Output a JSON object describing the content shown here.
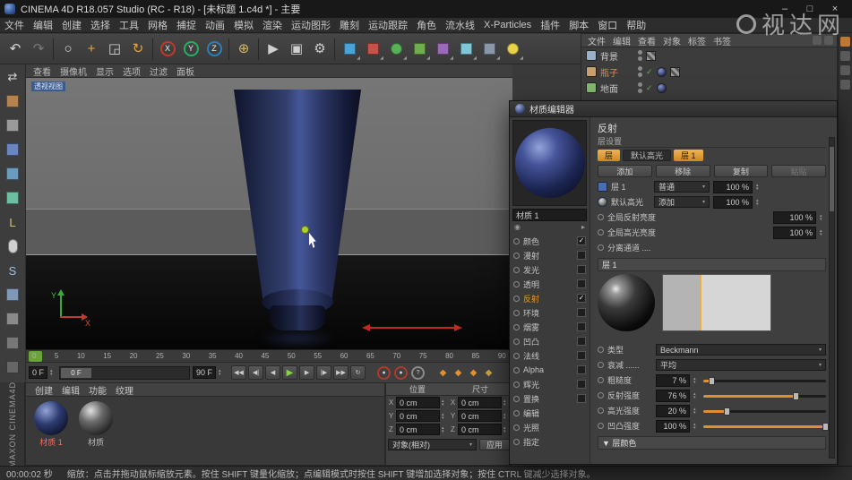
{
  "title_bar": {
    "title": "CINEMA 4D R18.057 Studio (RC - R18) - [未标题 1.c4d *] - 主要",
    "minimize": "–",
    "maximize": "□",
    "close": "×"
  },
  "menu_bar": [
    "文件",
    "编辑",
    "创建",
    "选择",
    "工具",
    "网格",
    "捕捉",
    "动画",
    "模拟",
    "渲染",
    "运动图形",
    "雕刻",
    "运动跟踪",
    "角色",
    "流水线",
    "X-Particles",
    "插件",
    "脚本",
    "窗口",
    "帮助"
  ],
  "toolbar": {
    "groups": [
      {
        "items": [
          {
            "name": "undo-icon",
            "glyph": "↶",
            "color": "#d8d8d8"
          },
          {
            "name": "redo-icon",
            "glyph": "↷",
            "color": "#7a7a7a"
          }
        ]
      },
      {
        "items": [
          {
            "name": "live-selection-icon",
            "glyph": "○",
            "color": "#d8d8d8"
          },
          {
            "name": "move-tool-icon",
            "glyph": "+",
            "color": "#e8a43c"
          },
          {
            "name": "scale-tool-icon",
            "glyph": "◲",
            "color": "#d8d8d8"
          },
          {
            "name": "rotate-tool-icon",
            "glyph": "↻",
            "color": "#e8a43c"
          }
        ]
      },
      {
        "items": [
          {
            "name": "x-axis-lock-button",
            "glyph": "X",
            "ring": "#c0392b"
          },
          {
            "name": "y-axis-lock-button",
            "glyph": "Y",
            "ring": "#27ae60"
          },
          {
            "name": "z-axis-lock-button",
            "glyph": "Z",
            "ring": "#2980b9"
          }
        ]
      },
      {
        "items": [
          {
            "name": "coordinate-system-button",
            "glyph": "⊕",
            "color": "#d8b868"
          }
        ]
      },
      {
        "items": [
          {
            "name": "render-view-button",
            "glyph": "▶",
            "color": "#cfcfcf"
          },
          {
            "name": "render-picture-viewer-button",
            "glyph": "▣",
            "color": "#cfcfcf"
          },
          {
            "name": "render-settings-button",
            "glyph": "⚙",
            "color": "#cfcfcf"
          }
        ]
      },
      {
        "items": [
          {
            "name": "primitive-cube-button",
            "shape": "square",
            "fill": "#4aa3d8",
            "dd": true
          },
          {
            "name": "spline-pen-button",
            "shape": "square",
            "fill": "#c8524a",
            "dd": true
          },
          {
            "name": "subdivision-surface-button",
            "shape": "circle",
            "fill": "#58b058",
            "dd": true
          },
          {
            "name": "cloner-button",
            "shape": "square",
            "fill": "#6fae4e",
            "dd": true
          },
          {
            "name": "deformer-button",
            "shape": "square",
            "fill": "#9a6ab8",
            "dd": true
          },
          {
            "name": "environment-button",
            "shape": "square",
            "fill": "#7ec8d8",
            "dd": true
          },
          {
            "name": "camera-button",
            "shape": "square",
            "fill": "#8a97a8",
            "dd": true
          },
          {
            "name": "light-button",
            "shape": "circle",
            "fill": "#e8d24a",
            "dd": true
          }
        ]
      }
    ]
  },
  "left_toolbar": [
    {
      "name": "make-editable-icon",
      "glyph": "⇄",
      "color": "#cfcfcf"
    },
    {
      "name": "model-mode-icon",
      "shape": "square",
      "fill": "#b5824f"
    },
    {
      "name": "texture-mode-icon",
      "shape": "square",
      "fill": "#9a9a9a"
    },
    {
      "name": "points-mode-icon",
      "shape": "square",
      "fill": "#6a86c0"
    },
    {
      "name": "edges-mode-icon",
      "shape": "square",
      "fill": "#6a9cc0"
    },
    {
      "name": "polygons-mode-icon",
      "shape": "square",
      "fill": "#6ac0a0"
    },
    {
      "name": "axis-mode-icon",
      "glyph": "L",
      "color": "#d8c070"
    },
    {
      "name": "solo-mode-icon",
      "shape": "pill",
      "fill": "#d0d0d0"
    },
    {
      "name": "snap-toggle-icon",
      "glyph": "S",
      "color": "#9ec2e0"
    },
    {
      "name": "workplane-icon",
      "shape": "square",
      "fill": "#8098b8"
    },
    {
      "name": "magnet-icon",
      "shape": "square",
      "fill": "#8a8a8a"
    },
    {
      "name": "array-grid-icon",
      "shape": "square",
      "fill": "#777777"
    },
    {
      "name": "modeling-settings-icon",
      "shape": "square",
      "fill": "#666666"
    }
  ],
  "viewport": {
    "menu": [
      "查看",
      "摄像机",
      "显示",
      "选项",
      "过滤",
      "面板"
    ],
    "view_label": "透视视图",
    "axis_x": "X",
    "axis_y": "Y"
  },
  "timeline_ticks": [
    "0",
    "5",
    "10",
    "15",
    "20",
    "25",
    "30",
    "35",
    "40",
    "45",
    "50",
    "55",
    "60",
    "65",
    "70",
    "75",
    "80",
    "85",
    "90"
  ],
  "playback": {
    "current_frame": "0 F",
    "slider_handle": "0 F",
    "end_frame": "90 F",
    "transport": [
      {
        "name": "goto-start-button",
        "glyph": "◀◀"
      },
      {
        "name": "prev-key-button",
        "glyph": "◀|"
      },
      {
        "name": "prev-frame-button",
        "glyph": "◀"
      },
      {
        "name": "play-button",
        "glyph": "▶",
        "play": true
      },
      {
        "name": "next-frame-button",
        "glyph": "▶"
      },
      {
        "name": "next-key-button",
        "glyph": "|▶"
      },
      {
        "name": "goto-end-button",
        "glyph": "▶▶"
      },
      {
        "name": "loop-button",
        "glyph": "↻"
      }
    ],
    "record_buttons": [
      {
        "name": "record-keyframe-button",
        "glyph": "●",
        "gray": false
      },
      {
        "name": "autokey-button",
        "glyph": "●",
        "gray": false
      },
      {
        "name": "keyframe-help-button",
        "glyph": "?",
        "gray": true
      }
    ],
    "key_icons": [
      {
        "name": "keyframe-position-icon",
        "glyph": "◆",
        "color": "#e0912f"
      },
      {
        "name": "keyframe-scale-icon",
        "glyph": "◆",
        "color": "#e0912f"
      },
      {
        "name": "keyframe-rotation-icon",
        "glyph": "◆",
        "color": "#e0912f"
      },
      {
        "name": "keyframe-parameter-icon",
        "glyph": "◆",
        "color": "#c8a040"
      }
    ]
  },
  "object_manager": {
    "menu": [
      "文件",
      "编辑",
      "查看",
      "对象",
      "标签",
      "书签"
    ],
    "objects": [
      {
        "name": "背景",
        "selected": false,
        "icon": "#9ab0c8",
        "tags": [
          "texture"
        ]
      },
      {
        "name": "瓶子",
        "selected": true,
        "icon": "#c8a070",
        "tags": [
          "check",
          "material",
          "texture"
        ]
      },
      {
        "name": "地面",
        "selected": false,
        "icon": "#84b870",
        "tags": [
          "check",
          "material"
        ]
      }
    ]
  },
  "material_manager": {
    "tabs": [
      "创建",
      "编辑",
      "功能",
      "纹理"
    ],
    "materials": [
      {
        "name": "材质 1",
        "selected": true,
        "ball": "navy"
      },
      {
        "name": "材质",
        "selected": false,
        "ball": "dark"
      }
    ]
  },
  "coordinates": {
    "headers": [
      "位置",
      "尺寸"
    ],
    "axis_labels": [
      "X",
      "Y",
      "Z"
    ],
    "pos": {
      "x": "0 cm",
      "y": "0 cm",
      "z": "0 cm"
    },
    "size": {
      "x": "0 cm",
      "y": "0 cm",
      "z": "0 cm"
    },
    "mode_dropdown": "对象(相对)",
    "apply_button": "应用"
  },
  "material_editor": {
    "window_title": "材质编辑器",
    "material_name": "材质 1",
    "channels": [
      {
        "label": "颜色",
        "checked": true
      },
      {
        "label": "漫射",
        "checked": false
      },
      {
        "label": "发光",
        "checked": false
      },
      {
        "label": "透明",
        "checked": false
      },
      {
        "label": "反射",
        "checked": true,
        "active": true
      },
      {
        "label": "环境",
        "checked": false
      },
      {
        "label": "烟雾",
        "checked": false
      },
      {
        "label": "凹凸",
        "checked": false
      },
      {
        "label": "法线",
        "checked": false
      },
      {
        "label": "Alpha",
        "checked": false
      },
      {
        "label": "辉光",
        "checked": false
      },
      {
        "label": "置换",
        "checked": false
      },
      {
        "label": "编辑",
        "page": true
      },
      {
        "label": "光照",
        "page": true
      },
      {
        "label": "指定",
        "page": true
      }
    ],
    "reflectance": {
      "page_title": "反射",
      "layer_settings_label": "层设置",
      "tabs": [
        {
          "label": "层",
          "active": true
        },
        {
          "label": "默认高光",
          "active": false
        },
        {
          "label": "层 1",
          "active": true
        }
      ],
      "buttons": [
        {
          "label": "添加",
          "enabled": true
        },
        {
          "label": "移除",
          "enabled": true
        },
        {
          "label": "复制",
          "enabled": true
        },
        {
          "label": "粘贴",
          "enabled": false
        }
      ],
      "layers": [
        {
          "name": "层 1",
          "blend": "普通",
          "strength": "100 %"
        },
        {
          "name": "默认高光",
          "blend": "添加",
          "strength": "100 %"
        }
      ],
      "globals": [
        {
          "label": "全局反射亮度",
          "value": "100 %"
        },
        {
          "label": "全局高光亮度",
          "value": "100 %"
        }
      ],
      "separate_label": "分离通道 ....",
      "layer_section_title": "层 1",
      "type_label": "类型",
      "type_value": "Beckmann",
      "attenuation_label": "衰减 ......",
      "attenuation_value": "平均",
      "params": [
        {
          "label": "粗糙度",
          "value": "7 %",
          "pct": 7
        },
        {
          "label": "反射强度",
          "value": "76 %",
          "pct": 76
        },
        {
          "label": "高光强度",
          "value": "20 %",
          "pct": 20
        },
        {
          "label": "凹凸强度",
          "value": "100 %",
          "pct": 100
        }
      ],
      "layer_color_label": "▼ 层颜色"
    }
  },
  "right_strip_icons": [
    {
      "name": "layout-panel-icon",
      "color": "#c07830"
    },
    {
      "name": "content-browser-icon",
      "color": "#5a5a5a"
    },
    {
      "name": "structure-panel-icon",
      "color": "#5a5a5a"
    },
    {
      "name": "coordinates-panel-icon",
      "color": "#5a5a5a"
    }
  ],
  "status_bar": {
    "time": "00:00:02 秒",
    "message": "缩放：点击并拖动鼠标缩放元素。按住 SHIFT 键量化缩放；点编辑模式时按住 SHIFT 键增加选择对象；按住 CTRL 键减少选择对象。"
  },
  "watermark": "视达网",
  "brand": "MAXON CINEMA4D"
}
